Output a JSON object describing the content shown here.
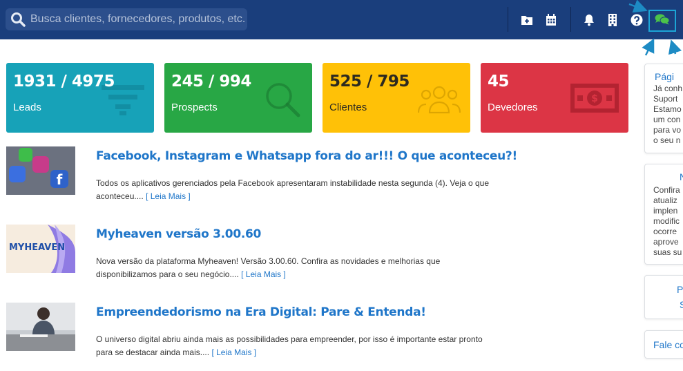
{
  "header": {
    "search_placeholder": "Busca clientes, fornecedores, produtos, etc...",
    "icons": [
      "search-icon",
      "folder-plus-icon",
      "calendar-icon",
      "bell-icon",
      "building-icon",
      "help-icon",
      "chat-icon"
    ],
    "colors": {
      "bar": "#1a3e7c",
      "highlight": "#1ca5d6",
      "chat": "#4cc24a"
    }
  },
  "cards": [
    {
      "value": "1931 / 4975",
      "label": "Leads",
      "color": "#17a2b8",
      "icon": "funnel-icon"
    },
    {
      "value": "245 / 994",
      "label": "Prospects",
      "color": "#28a745",
      "icon": "magnifier-icon"
    },
    {
      "value": "525 / 795",
      "label": "Clientes",
      "color": "#ffc107",
      "icon": "users-icon"
    },
    {
      "value": "45",
      "label": "Devedores",
      "color": "#dc3545",
      "icon": "money-icon"
    }
  ],
  "news": [
    {
      "title": "Facebook, Instagram e Whatsapp fora do ar!!! O que aconteceu?!",
      "desc": "Todos os aplicativos gerenciados pela Facebook apresentaram instabilidade nesta segunda (4). Veja o que aconteceu....",
      "more": "[ Leia Mais ]"
    },
    {
      "title": "Myheaven versão 3.00.60",
      "desc": "Nova versão da plataforma Myheaven! Versão 3.00.60. Confira as novidades e melhorias que disponibilizamos para o seu negócio....",
      "more": "[ Leia Mais ]",
      "thumb_text": "MYHEAVEN"
    },
    {
      "title": "Empreendedorismo na Era Digital: Pare & Entenda!",
      "desc": "O universo digital abriu ainda mais as possibilidades para empreender, por isso é importante estar pronto para se destacar ainda mais....",
      "more": "[ Leia Mais ]"
    }
  ],
  "sidebar": {
    "card1": {
      "heading": "Pági",
      "lines": [
        "Já conh",
        "Suport",
        "Estamo",
        "um con",
        "para vo",
        "o seu n"
      ]
    },
    "card2": {
      "heading": "N",
      "lines": [
        "Confira",
        "atualiz",
        "implen",
        "modific",
        "ocorre",
        "aprove",
        "suas su"
      ]
    },
    "card3": {
      "lines": [
        "P",
        "S"
      ]
    },
    "card4": {
      "heading": "Fale co"
    }
  }
}
